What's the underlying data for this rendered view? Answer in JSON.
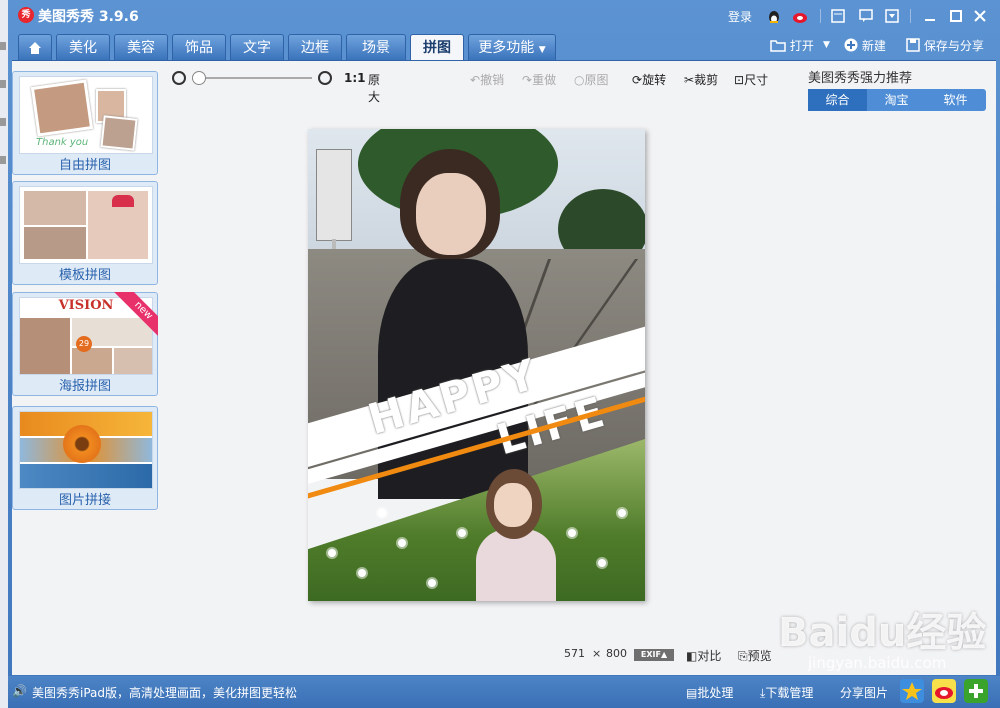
{
  "window": {
    "title": "美图秀秀 3.9.6",
    "logo_text": "秀",
    "login": "登录"
  },
  "tabs": [
    {
      "label": ""
    },
    {
      "label": "美化"
    },
    {
      "label": "美容"
    },
    {
      "label": "饰品"
    },
    {
      "label": "文字"
    },
    {
      "label": "边框"
    },
    {
      "label": "场景"
    },
    {
      "label": "拼图"
    },
    {
      "label": "更多功能"
    }
  ],
  "right_tools": {
    "open": "打开",
    "new": "新建",
    "save_share": "保存与分享"
  },
  "sidebar": {
    "items": [
      {
        "label": "自由拼图",
        "thumb_caption": "Thank you"
      },
      {
        "label": "模板拼图"
      },
      {
        "label": "海报拼图",
        "badge": "new",
        "thumb_caption": "VISION"
      },
      {
        "label": "图片拼接"
      }
    ]
  },
  "zoom": {
    "ratio": "1:1",
    "original_size": "原大"
  },
  "edit_tools": {
    "undo": "撤销",
    "redo": "重做",
    "original": "原图",
    "rotate": "旋转",
    "crop": "裁剪",
    "resize": "尺寸"
  },
  "recommend": {
    "title": "美图秀秀强力推荐",
    "tabs": [
      "综合",
      "淘宝",
      "软件"
    ],
    "selected": "综合"
  },
  "image_text": {
    "line1": "HAPPY",
    "line2": "LIFE"
  },
  "status": {
    "width": "571",
    "times": "×",
    "height": "800",
    "exif": "EXIF",
    "compare": "对比",
    "preview": "预览"
  },
  "bottom": {
    "promo": "美图秀秀iPad版，高清处理画面，美化拼图更轻松",
    "batch": "批处理",
    "download": "下载管理",
    "share": "分享图片"
  },
  "watermark": {
    "main": "Baidu经验",
    "sub": "jingyan.baidu.com"
  }
}
